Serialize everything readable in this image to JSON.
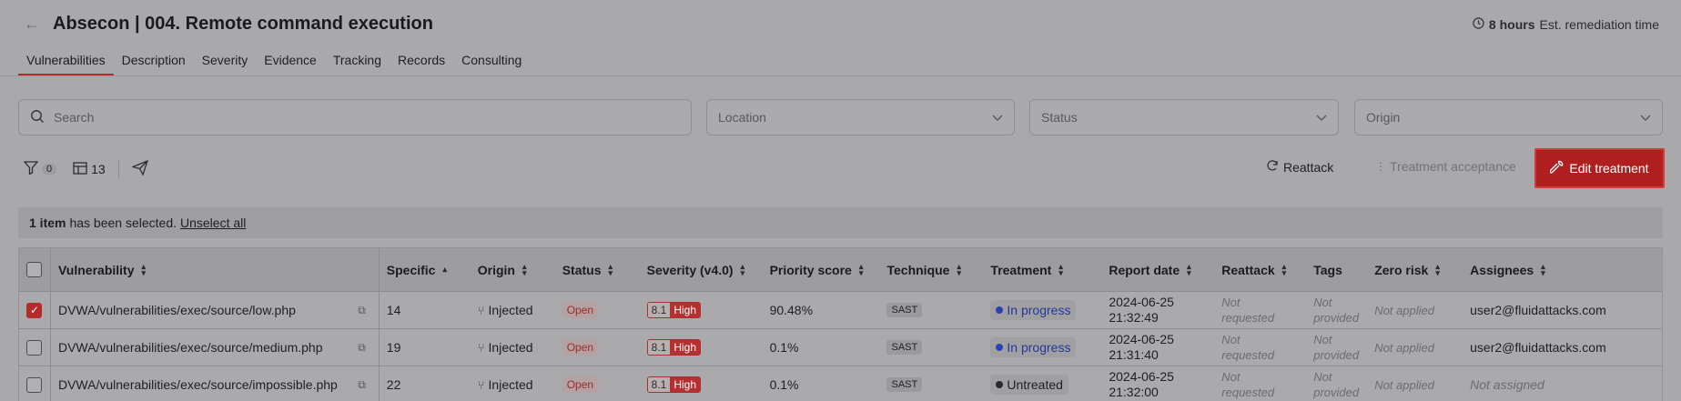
{
  "header": {
    "title": "Absecon | 004. Remote command execution",
    "remediation_hours": "8 hours",
    "remediation_label": "Est. remediation time"
  },
  "tabs": [
    {
      "label": "Vulnerabilities",
      "active": true
    },
    {
      "label": "Description"
    },
    {
      "label": "Severity"
    },
    {
      "label": "Evidence"
    },
    {
      "label": "Tracking"
    },
    {
      "label": "Records"
    },
    {
      "label": "Consulting"
    }
  ],
  "filters": {
    "search_placeholder": "Search",
    "location_placeholder": "Location",
    "status_placeholder": "Status",
    "origin_placeholder": "Origin"
  },
  "toolbar": {
    "filter_count": "0",
    "columns_count": "13",
    "reattack_label": "Reattack",
    "treatment_acceptance_label": "Treatment acceptance",
    "edit_treatment_label": "Edit treatment"
  },
  "selection": {
    "count_text": "1 item",
    "message": "has been selected.",
    "unselect_label": "Unselect all"
  },
  "table": {
    "columns": [
      "Vulnerability",
      "Specific",
      "Origin",
      "Status",
      "Severity (v4.0)",
      "Priority score",
      "Technique",
      "Treatment",
      "Report date",
      "Reattack",
      "Tags",
      "Zero risk",
      "Assignees"
    ],
    "rows": [
      {
        "checked": true,
        "vulnerability": "DVWA/vulnerabilities/exec/source/low.php",
        "specific": "14",
        "origin": "Injected",
        "status": "Open",
        "severity_score": "8.1",
        "severity_level": "High",
        "priority": "90.48%",
        "technique": "SAST",
        "treatment": "In progress",
        "report_date": "2024-06-25",
        "report_time": "21:32:49",
        "reattack": "Not requested",
        "tags": "Not provided",
        "zero_risk": "Not applied",
        "assignee": "user2@fluidattacks.com"
      },
      {
        "checked": false,
        "vulnerability": "DVWA/vulnerabilities/exec/source/medium.php",
        "specific": "19",
        "origin": "Injected",
        "status": "Open",
        "severity_score": "8.1",
        "severity_level": "High",
        "priority": "0.1%",
        "technique": "SAST",
        "treatment": "In progress",
        "report_date": "2024-06-25",
        "report_time": "21:31:40",
        "reattack": "Not requested",
        "tags": "Not provided",
        "zero_risk": "Not applied",
        "assignee": "user2@fluidattacks.com"
      },
      {
        "checked": false,
        "vulnerability": "DVWA/vulnerabilities/exec/source/impossible.php",
        "specific": "22",
        "origin": "Injected",
        "status": "Open",
        "severity_score": "8.1",
        "severity_level": "High",
        "priority": "0.1%",
        "technique": "SAST",
        "treatment": "Untreated",
        "report_date": "2024-06-25",
        "report_time": "21:32:00",
        "reattack": "Not requested",
        "tags": "Not provided",
        "zero_risk": "Not applied",
        "assignee": "Not assigned"
      }
    ]
  }
}
